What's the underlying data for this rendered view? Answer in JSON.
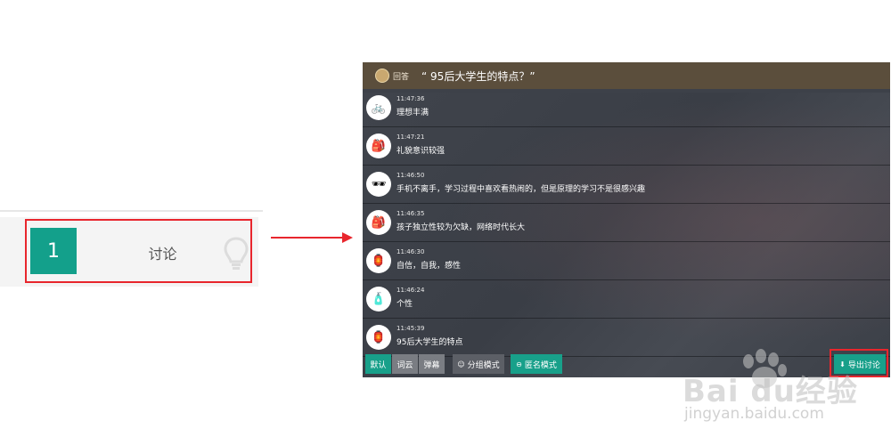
{
  "activity": {
    "number": "1",
    "label": "讨论",
    "icon": "lightbulb-icon"
  },
  "screen": {
    "header": {
      "user": "回答",
      "title": "“ 95后大学生的特点？”"
    },
    "messages": [
      {
        "time": "11:47:36",
        "text": "理想丰满",
        "avatar": "🚲"
      },
      {
        "time": "11:47:21",
        "text": "礼貌意识较强",
        "avatar": "🎒"
      },
      {
        "time": "11:46:50",
        "text": "手机不离手，学习过程中喜欢看热闹的，但是原理的学习不是很感兴趣",
        "avatar": "🕶"
      },
      {
        "time": "11:46:35",
        "text": "孩子独立性较为欠缺，网络时代长大",
        "avatar": "🎒"
      },
      {
        "time": "11:46:30",
        "text": "自信，自我，感性",
        "avatar": "🏮"
      },
      {
        "time": "11:46:24",
        "text": "个性",
        "avatar": "🧴"
      },
      {
        "time": "11:45:39",
        "text": "95后大学生的特点",
        "avatar": "🏮"
      }
    ],
    "toolbar": {
      "default": "默认",
      "cloud": "词云",
      "barrage": "弹幕",
      "group": "分组模式",
      "anonymous": "匿名模式",
      "export": "导出讨论"
    }
  },
  "watermark": {
    "brand": "Bai du经验",
    "url": "jingyan.baidu.com"
  },
  "colors": {
    "accent": "#18a08a",
    "highlight": "#e8262d",
    "header": "#5b4e3c"
  }
}
